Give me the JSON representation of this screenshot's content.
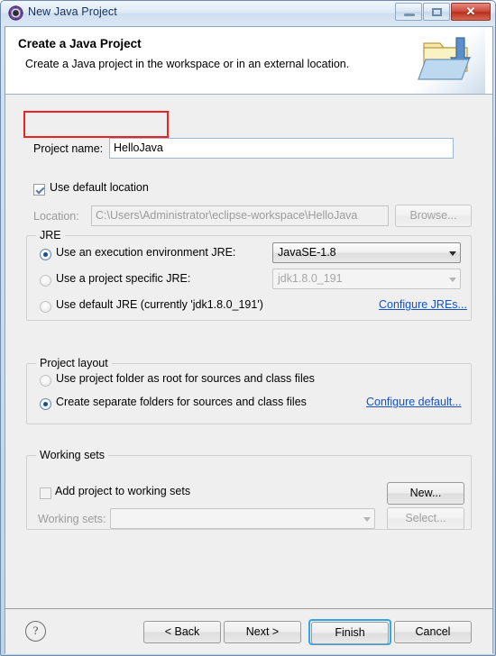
{
  "window": {
    "title": "New Java Project",
    "icon": "eclipse-wizard-icon",
    "controls": {
      "minimize": "minimize-button",
      "maximize": "maximize-button",
      "close_glyph": "✕"
    }
  },
  "header": {
    "title": "Create a Java Project",
    "description": "Create a Java project in the workspace or in an external location.",
    "banner_icon": "java-project-folder-icon"
  },
  "project_name": {
    "label": "Project name:",
    "value": "HelloJava",
    "placeholder": ""
  },
  "location": {
    "use_default_label": "Use default location",
    "use_default_checked": true,
    "label": "Location:",
    "value": "C:\\Users\\Administrator\\eclipse-workspace\\HelloJava",
    "browse_label": "Browse..."
  },
  "jre": {
    "group_title": "JRE",
    "option_execution_env": {
      "label": "Use an execution environment JRE:",
      "selected": true,
      "value": "JavaSE-1.8"
    },
    "option_project_specific": {
      "label": "Use a project specific JRE:",
      "selected": false,
      "value": "jdk1.8.0_191"
    },
    "option_default": {
      "label": "Use default JRE (currently 'jdk1.8.0_191')",
      "selected": false
    },
    "configure_link": "Configure JREs..."
  },
  "project_layout": {
    "group_title": "Project layout",
    "option_project_folder": {
      "label": "Use project folder as root for sources and class files",
      "selected": false
    },
    "option_separate_folders": {
      "label": "Create separate folders for sources and class files",
      "selected": true
    },
    "configure_link": "Configure default..."
  },
  "working_sets": {
    "group_title": "Working sets",
    "add_checkbox_label": "Add project to working sets",
    "add_checkbox_checked": false,
    "new_button": "New...",
    "label": "Working sets:",
    "value": "",
    "select_button": "Select..."
  },
  "buttons": {
    "help": "?",
    "back": "< Back",
    "next": "Next >",
    "finish": "Finish",
    "cancel": "Cancel",
    "default_button": "Finish"
  },
  "annotation": {
    "highlight_color": "#ee2222",
    "target": "project-name-row"
  }
}
